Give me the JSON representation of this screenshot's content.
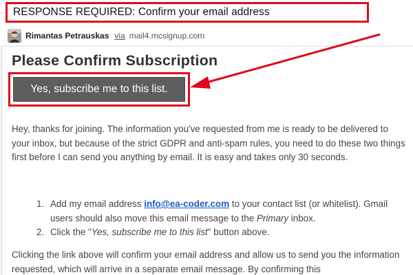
{
  "subject": {
    "text": "RESPONSE REQUIRED: Confirm your email address"
  },
  "sender": {
    "name": "Rimantas Petrauskas",
    "via_label": "via",
    "domain": "mail4.mcsignup.com"
  },
  "email": {
    "title": "Please Confirm Subscription",
    "cta_label": "Yes, subscribe me to this list.",
    "intro": "Hey, thanks for joining. The information you've requested from me is ready to be delivered to your inbox, but because of the strict GDPR and anti-spam rules, you need to do these two things first before I can send you anything by email. It is easy and takes only 30 seconds.",
    "steps": [
      {
        "num": "1.",
        "before": "Add my email address ",
        "link": "info@ea-coder.com",
        "after": " to your contact list (or whitelist). Gmail users should also move this email message to the ",
        "emph": "Primary",
        "end": " inbox."
      },
      {
        "num": "2.",
        "before": "Click the \"",
        "emph": "Yes, subscribe me to this list",
        "after": "\" button above."
      }
    ],
    "outro": "Clicking the link above will confirm your email address and allow us to send you the information requested, which will arrive in a separate email message. By confirming this"
  },
  "colors": {
    "highlight": "#e0081c",
    "button": "#5e5e5e",
    "link": "#1a5bc4"
  }
}
